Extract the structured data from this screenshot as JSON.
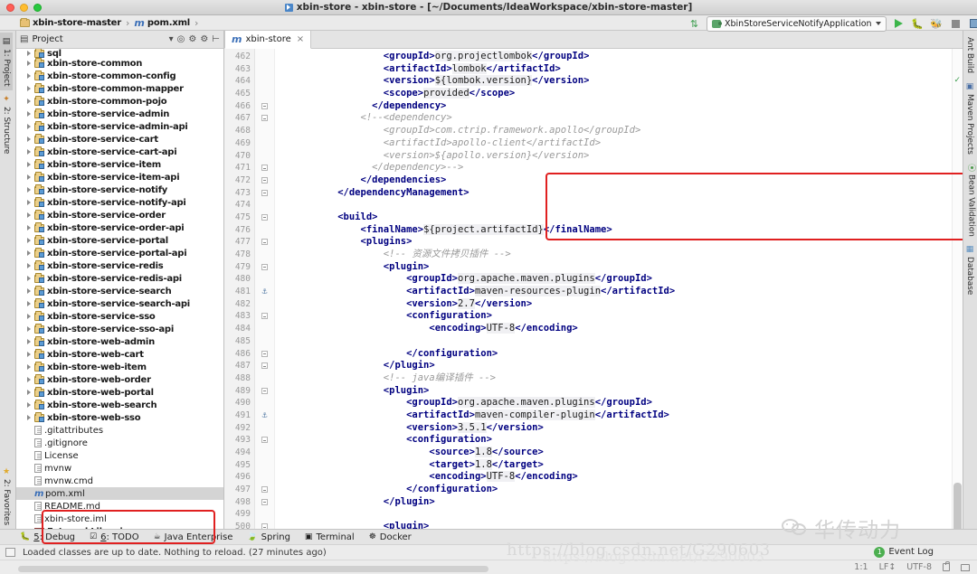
{
  "window": {
    "title": "xbin-store - xbin-store - [~/Documents/IdeaWorkspace/xbin-store-master]",
    "app_icon": "intellij-idea-icon"
  },
  "breadcrumb": {
    "items": [
      {
        "label": "xbin-store-master",
        "icon": "folder-icon"
      },
      {
        "label": "pom.xml",
        "icon": "maven-file-icon"
      }
    ],
    "separator": "›"
  },
  "run_config": {
    "name": "XbinStoreServiceNotifyApplication",
    "icon": "spring-boot-icon",
    "dropdown_caret": "▾",
    "buttons": [
      {
        "name": "run-button",
        "label": "Run"
      },
      {
        "name": "debug-button",
        "label": "Debug"
      },
      {
        "name": "run-coverage-button",
        "label": "Run with Coverage"
      },
      {
        "name": "stop-button",
        "label": "Stop"
      },
      {
        "name": "layout-button",
        "label": "Layout"
      },
      {
        "name": "search-everywhere-button",
        "label": "Search Everywhere"
      }
    ],
    "sort_icon": "sort-updown-icon"
  },
  "left_tool_strip": {
    "tabs": [
      {
        "label": "1: Project",
        "icon": "project-icon",
        "active": true
      },
      {
        "label": "2: Structure",
        "icon": "structure-icon",
        "active": false
      },
      {
        "label": "2: Favorites",
        "icon": "star-icon",
        "active": false
      }
    ]
  },
  "right_tool_strip": {
    "tabs": [
      {
        "label": "Ant Build",
        "icon": "ant-icon"
      },
      {
        "label": "Maven Projects",
        "icon": "maven-icon"
      },
      {
        "label": "Bean Validation",
        "icon": "bean-icon"
      },
      {
        "label": "Database",
        "icon": "database-icon"
      }
    ]
  },
  "project_panel": {
    "title": "Project",
    "header_icons": [
      "caret-down-icon",
      "collapse-all-icon",
      "expand-all-icon",
      "settings-gear-icon",
      "hide-icon"
    ],
    "tree": [
      {
        "label": "sql",
        "type": "module",
        "expanded": true,
        "clipped": true
      },
      {
        "label": "xbin-store-common",
        "type": "module"
      },
      {
        "label": "xbin-store-common-config",
        "type": "module"
      },
      {
        "label": "xbin-store-common-mapper",
        "type": "module"
      },
      {
        "label": "xbin-store-common-pojo",
        "type": "module"
      },
      {
        "label": "xbin-store-service-admin",
        "type": "module"
      },
      {
        "label": "xbin-store-service-admin-api",
        "type": "module"
      },
      {
        "label": "xbin-store-service-cart",
        "type": "module"
      },
      {
        "label": "xbin-store-service-cart-api",
        "type": "module"
      },
      {
        "label": "xbin-store-service-item",
        "type": "module"
      },
      {
        "label": "xbin-store-service-item-api",
        "type": "module"
      },
      {
        "label": "xbin-store-service-notify",
        "type": "module"
      },
      {
        "label": "xbin-store-service-notify-api",
        "type": "module"
      },
      {
        "label": "xbin-store-service-order",
        "type": "module"
      },
      {
        "label": "xbin-store-service-order-api",
        "type": "module"
      },
      {
        "label": "xbin-store-service-portal",
        "type": "module"
      },
      {
        "label": "xbin-store-service-portal-api",
        "type": "module"
      },
      {
        "label": "xbin-store-service-redis",
        "type": "module"
      },
      {
        "label": "xbin-store-service-redis-api",
        "type": "module"
      },
      {
        "label": "xbin-store-service-search",
        "type": "module"
      },
      {
        "label": "xbin-store-service-search-api",
        "type": "module"
      },
      {
        "label": "xbin-store-service-sso",
        "type": "module"
      },
      {
        "label": "xbin-store-service-sso-api",
        "type": "module"
      },
      {
        "label": "xbin-store-web-admin",
        "type": "module"
      },
      {
        "label": "xbin-store-web-cart",
        "type": "module"
      },
      {
        "label": "xbin-store-web-item",
        "type": "module"
      },
      {
        "label": "xbin-store-web-order",
        "type": "module"
      },
      {
        "label": "xbin-store-web-portal",
        "type": "module"
      },
      {
        "label": "xbin-store-web-search",
        "type": "module"
      },
      {
        "label": "xbin-store-web-sso",
        "type": "module"
      },
      {
        "label": ".gitattributes",
        "type": "file"
      },
      {
        "label": ".gitignore",
        "type": "file"
      },
      {
        "label": "License",
        "type": "file"
      },
      {
        "label": "mvnw",
        "type": "file"
      },
      {
        "label": "mvnw.cmd",
        "type": "file"
      },
      {
        "label": "pom.xml",
        "type": "maven",
        "selected": true
      },
      {
        "label": "README.md",
        "type": "file"
      },
      {
        "label": "xbin-store.iml",
        "type": "iml"
      },
      {
        "label": "External Libraries",
        "type": "library"
      }
    ]
  },
  "editor": {
    "tab": {
      "label": "xbin-store",
      "icon": "maven-file-icon",
      "close": "×"
    },
    "first_line_number": 462,
    "lines": [
      {
        "n": 462,
        "fold": "",
        "indent": 9,
        "segments": [
          {
            "t": "tag",
            "v": "<groupId>"
          },
          {
            "t": "txt",
            "v": "org.projectlombok"
          },
          {
            "t": "tag",
            "v": "</groupId>"
          }
        ]
      },
      {
        "n": 463,
        "fold": "",
        "indent": 9,
        "segments": [
          {
            "t": "tag",
            "v": "<artifactId>"
          },
          {
            "t": "txt",
            "v": "lombok"
          },
          {
            "t": "tag",
            "v": "</artifactId>"
          }
        ]
      },
      {
        "n": 464,
        "fold": "",
        "indent": 9,
        "segments": [
          {
            "t": "tag",
            "v": "<version>"
          },
          {
            "t": "txt",
            "v": "${lombok.version}"
          },
          {
            "t": "tag",
            "v": "</version>"
          }
        ]
      },
      {
        "n": 465,
        "fold": "",
        "indent": 9,
        "segments": [
          {
            "t": "tag",
            "v": "<scope>"
          },
          {
            "t": "txt",
            "v": "provided"
          },
          {
            "t": "tag",
            "v": "</scope>"
          }
        ]
      },
      {
        "n": 466,
        "fold": "minus",
        "indent": 8,
        "segments": [
          {
            "t": "tag",
            "v": "</dependency>"
          }
        ]
      },
      {
        "n": 467,
        "fold": "minus",
        "indent": 7,
        "segments": [
          {
            "t": "cmt",
            "v": "<!--<dependency>"
          }
        ]
      },
      {
        "n": 468,
        "fold": "",
        "indent": 9,
        "segments": [
          {
            "t": "cmt",
            "v": "<groupId>com.ctrip.framework.apollo</groupId>"
          }
        ]
      },
      {
        "n": 469,
        "fold": "",
        "indent": 9,
        "segments": [
          {
            "t": "cmt",
            "v": "<artifactId>apollo-client</artifactId>"
          }
        ]
      },
      {
        "n": 470,
        "fold": "",
        "indent": 9,
        "segments": [
          {
            "t": "cmt",
            "v": "<version>${apollo.version}</version>"
          }
        ]
      },
      {
        "n": 471,
        "fold": "minus",
        "indent": 8,
        "segments": [
          {
            "t": "cmt",
            "v": "</dependency>-->"
          }
        ]
      },
      {
        "n": 472,
        "fold": "minus",
        "indent": 7,
        "segments": [
          {
            "t": "tag",
            "v": "</dependencies>"
          }
        ]
      },
      {
        "n": 473,
        "fold": "minus",
        "indent": 5,
        "segments": [
          {
            "t": "tag",
            "v": "</dependencyManagement>"
          }
        ]
      },
      {
        "n": 474,
        "fold": "",
        "indent": 0,
        "segments": []
      },
      {
        "n": 475,
        "fold": "minus",
        "indent": 5,
        "segments": [
          {
            "t": "tag",
            "v": "<build>"
          }
        ]
      },
      {
        "n": 476,
        "fold": "",
        "indent": 7,
        "segments": [
          {
            "t": "tag",
            "v": "<finalName>"
          },
          {
            "t": "txt",
            "v": "${project.artifactId}"
          },
          {
            "t": "tag",
            "v": "</finalName>"
          }
        ]
      },
      {
        "n": 477,
        "fold": "minus",
        "indent": 7,
        "segments": [
          {
            "t": "tag",
            "v": "<plugins>"
          }
        ]
      },
      {
        "n": 478,
        "fold": "",
        "indent": 9,
        "segments": [
          {
            "t": "cmt",
            "v": "<!-- 资源文件拷贝插件 -->"
          }
        ]
      },
      {
        "n": 479,
        "fold": "minus",
        "indent": 9,
        "segments": [
          {
            "t": "tag",
            "v": "<plugin>"
          }
        ]
      },
      {
        "n": 480,
        "fold": "",
        "indent": 11,
        "segments": [
          {
            "t": "tag",
            "v": "<groupId>"
          },
          {
            "t": "txt",
            "v": "org.apache.maven.plugins"
          },
          {
            "t": "tag",
            "v": "</groupId>"
          }
        ]
      },
      {
        "n": 481,
        "fold": "",
        "gutter_icon": "maven-marker-icon",
        "indent": 11,
        "segments": [
          {
            "t": "tag",
            "v": "<artifactId>"
          },
          {
            "t": "txt",
            "v": "maven-resources-plugin"
          },
          {
            "t": "tag",
            "v": "</artifactId>"
          }
        ]
      },
      {
        "n": 482,
        "fold": "",
        "indent": 11,
        "segments": [
          {
            "t": "tag",
            "v": "<version>"
          },
          {
            "t": "txt",
            "v": "2.7"
          },
          {
            "t": "tag",
            "v": "</version>"
          }
        ]
      },
      {
        "n": 483,
        "fold": "minus",
        "indent": 11,
        "segments": [
          {
            "t": "tag",
            "v": "<configuration>"
          }
        ]
      },
      {
        "n": 484,
        "fold": "",
        "indent": 13,
        "segments": [
          {
            "t": "tag",
            "v": "<encoding>"
          },
          {
            "t": "txt",
            "v": "UTF-8"
          },
          {
            "t": "tag",
            "v": "</encoding>"
          }
        ]
      },
      {
        "n": 485,
        "fold": "",
        "indent": 0,
        "segments": []
      },
      {
        "n": 486,
        "fold": "minus",
        "indent": 11,
        "segments": [
          {
            "t": "tag",
            "v": "</configuration>"
          }
        ]
      },
      {
        "n": 487,
        "fold": "minus",
        "indent": 9,
        "segments": [
          {
            "t": "tag",
            "v": "</plugin>"
          }
        ]
      },
      {
        "n": 488,
        "fold": "",
        "indent": 9,
        "segments": [
          {
            "t": "cmt",
            "v": "<!-- java编译插件 -->"
          }
        ]
      },
      {
        "n": 489,
        "fold": "minus",
        "indent": 9,
        "segments": [
          {
            "t": "tag",
            "v": "<plugin>"
          }
        ]
      },
      {
        "n": 490,
        "fold": "",
        "indent": 11,
        "segments": [
          {
            "t": "tag",
            "v": "<groupId>"
          },
          {
            "t": "txt",
            "v": "org.apache.maven.plugins"
          },
          {
            "t": "tag",
            "v": "</groupId>"
          }
        ]
      },
      {
        "n": 491,
        "fold": "",
        "gutter_icon": "maven-marker-icon",
        "indent": 11,
        "segments": [
          {
            "t": "tag",
            "v": "<artifactId>"
          },
          {
            "t": "txt",
            "v": "maven-compiler-plugin"
          },
          {
            "t": "tag",
            "v": "</artifactId>"
          }
        ]
      },
      {
        "n": 492,
        "fold": "",
        "indent": 11,
        "segments": [
          {
            "t": "tag",
            "v": "<version>"
          },
          {
            "t": "txt",
            "v": "3.5.1"
          },
          {
            "t": "tag",
            "v": "</version>"
          }
        ]
      },
      {
        "n": 493,
        "fold": "minus",
        "indent": 11,
        "segments": [
          {
            "t": "tag",
            "v": "<configuration>"
          }
        ]
      },
      {
        "n": 494,
        "fold": "",
        "indent": 13,
        "segments": [
          {
            "t": "tag",
            "v": "<source>"
          },
          {
            "t": "txt",
            "v": "1.8"
          },
          {
            "t": "tag",
            "v": "</source>"
          }
        ]
      },
      {
        "n": 495,
        "fold": "",
        "indent": 13,
        "segments": [
          {
            "t": "tag",
            "v": "<target>"
          },
          {
            "t": "txt",
            "v": "1.8"
          },
          {
            "t": "tag",
            "v": "</target>"
          }
        ]
      },
      {
        "n": 496,
        "fold": "",
        "indent": 13,
        "segments": [
          {
            "t": "tag",
            "v": "<encoding>"
          },
          {
            "t": "txt",
            "v": "UTF-8"
          },
          {
            "t": "tag",
            "v": "</encoding>"
          }
        ]
      },
      {
        "n": 497,
        "fold": "minus",
        "indent": 11,
        "segments": [
          {
            "t": "tag",
            "v": "</configuration>"
          }
        ]
      },
      {
        "n": 498,
        "fold": "minus",
        "indent": 9,
        "segments": [
          {
            "t": "tag",
            "v": "</plugin>"
          }
        ]
      },
      {
        "n": 499,
        "fold": "",
        "indent": 0,
        "segments": []
      },
      {
        "n": 500,
        "fold": "minus",
        "indent": 9,
        "segments": [
          {
            "t": "tag",
            "v": "<plugin>"
          }
        ]
      }
    ]
  },
  "annotations": {
    "color": "#e02020",
    "boxes": [
      {
        "name": "code-highlight-box",
        "target": "commented-apollo-dependency"
      },
      {
        "name": "project-files-highlight-box",
        "target": "mvnw.cmd / pom.xml / README.md"
      }
    ]
  },
  "bottom_tabs": [
    {
      "label": "5: Debug",
      "key": "5",
      "icon": "bug-icon"
    },
    {
      "label": "6: TODO",
      "key": "6",
      "icon": "todo-icon"
    },
    {
      "label": "Java Enterprise",
      "icon": "java-ee-icon"
    },
    {
      "label": "Spring",
      "icon": "spring-leaf-icon"
    },
    {
      "label": "Terminal",
      "icon": "terminal-icon"
    },
    {
      "label": "Docker",
      "icon": "docker-icon"
    }
  ],
  "status_bar": {
    "message": "Loaded classes are up to date. Nothing to reload. (27 minutes ago)",
    "icon": "memory-indicator-icon",
    "event_log": {
      "label": "Event Log",
      "count": "1"
    }
  },
  "bottom_bar": {
    "caret_position": "1:1",
    "line_separator": "LF↕",
    "encoding": "UTF-8",
    "lock_icon": "lock-icon",
    "print_icon": "printer-icon"
  },
  "watermarks": {
    "wechat_text": "华传动力",
    "url": "https://blog.csdn.net/G290603",
    "url_shadow": "https://blog.csdn.net/G290603"
  }
}
